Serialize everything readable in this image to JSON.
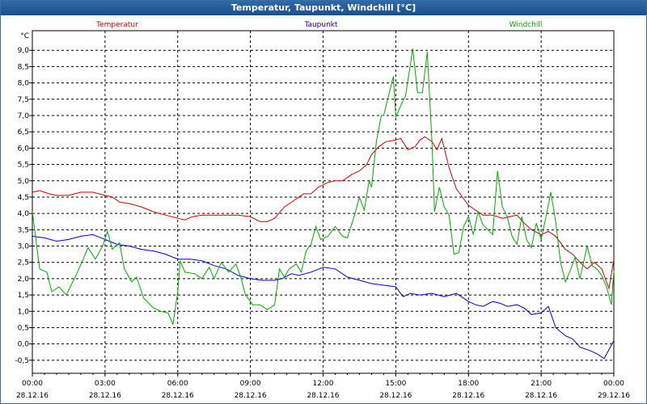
{
  "window": {
    "title": "Temperatur, Taupunkt, Windchill [°C]"
  },
  "chart_data": {
    "type": "line",
    "title": "Temperatur, Taupunkt, Windchill [°C]",
    "ylabel": "°C",
    "ylim": [
      -0.9,
      9.6
    ],
    "xlim_hours": [
      0,
      24
    ],
    "yticks": [
      -0.5,
      0.0,
      0.5,
      1.0,
      1.5,
      2.0,
      2.5,
      3.0,
      3.5,
      4.0,
      4.5,
      5.0,
      5.5,
      6.0,
      6.5,
      7.0,
      7.5,
      8.0,
      8.5,
      9.0
    ],
    "ytick_labels": [
      "-0,5",
      "0,0",
      "0,5",
      "1,0",
      "1,5",
      "2,0",
      "2,5",
      "3,0",
      "3,5",
      "4,0",
      "4,5",
      "5,0",
      "5,5",
      "6,0",
      "6,5",
      "7,0",
      "7,5",
      "8,0",
      "8,5",
      "9,0"
    ],
    "xticks": [
      {
        "hour": 0,
        "time": "00:00",
        "date": "28.12.16"
      },
      {
        "hour": 3,
        "time": "03:00",
        "date": "28.12.16"
      },
      {
        "hour": 6,
        "time": "06:00",
        "date": "28.12.16"
      },
      {
        "hour": 9,
        "time": "09:00",
        "date": "28.12.16"
      },
      {
        "hour": 12,
        "time": "12:00",
        "date": "28.12.16"
      },
      {
        "hour": 15,
        "time": "15:00",
        "date": "28.12.16"
      },
      {
        "hour": 18,
        "time": "18:00",
        "date": "28.12.16"
      },
      {
        "hour": 21,
        "time": "21:00",
        "date": "28.12.16"
      },
      {
        "hour": 24,
        "time": "00:00",
        "date": "29.12.16"
      }
    ],
    "grid": true,
    "legend_position": "top",
    "series": [
      {
        "name": "Temperatur",
        "color": "#cc0000",
        "points": [
          [
            0,
            4.65
          ],
          [
            0.3,
            4.7
          ],
          [
            0.7,
            4.6
          ],
          [
            1,
            4.55
          ],
          [
            1.5,
            4.55
          ],
          [
            2,
            4.65
          ],
          [
            2.5,
            4.65
          ],
          [
            3,
            4.55
          ],
          [
            3.3,
            4.5
          ],
          [
            3.6,
            4.35
          ],
          [
            4,
            4.3
          ],
          [
            4.5,
            4.2
          ],
          [
            5,
            4.05
          ],
          [
            5.5,
            3.95
          ],
          [
            6,
            3.85
          ],
          [
            6.3,
            3.8
          ],
          [
            6.6,
            3.9
          ],
          [
            7,
            3.95
          ],
          [
            7.5,
            3.95
          ],
          [
            8,
            3.95
          ],
          [
            8.5,
            3.95
          ],
          [
            9,
            3.9
          ],
          [
            9.4,
            3.75
          ],
          [
            9.7,
            3.75
          ],
          [
            10,
            3.85
          ],
          [
            10.4,
            4.2
          ],
          [
            10.8,
            4.4
          ],
          [
            11.2,
            4.6
          ],
          [
            11.5,
            4.6
          ],
          [
            11.8,
            4.8
          ],
          [
            12.2,
            4.95
          ],
          [
            12.5,
            5.0
          ],
          [
            12.8,
            5.0
          ],
          [
            13.2,
            5.2
          ],
          [
            13.5,
            5.3
          ],
          [
            13.8,
            5.5
          ],
          [
            14,
            5.8
          ],
          [
            14.3,
            6.05
          ],
          [
            14.6,
            6.2
          ],
          [
            15,
            6.25
          ],
          [
            15.2,
            6.3
          ],
          [
            15.5,
            5.95
          ],
          [
            15.8,
            6.05
          ],
          [
            16,
            6.25
          ],
          [
            16.2,
            6.35
          ],
          [
            16.5,
            6.2
          ],
          [
            16.7,
            5.95
          ],
          [
            16.9,
            6.3
          ],
          [
            17.2,
            5.4
          ],
          [
            17.5,
            4.75
          ],
          [
            17.8,
            4.45
          ],
          [
            18,
            4.25
          ],
          [
            18.3,
            4.1
          ],
          [
            18.6,
            3.95
          ],
          [
            19,
            3.95
          ],
          [
            19.4,
            3.85
          ],
          [
            19.7,
            3.9
          ],
          [
            20,
            3.95
          ],
          [
            20.3,
            3.7
          ],
          [
            20.6,
            3.5
          ],
          [
            21,
            3.35
          ],
          [
            21.3,
            3.45
          ],
          [
            21.6,
            3.3
          ],
          [
            22,
            2.9
          ],
          [
            22.3,
            2.75
          ],
          [
            22.6,
            2.5
          ],
          [
            22.9,
            2.3
          ],
          [
            23.2,
            2.5
          ],
          [
            23.5,
            2.3
          ],
          [
            23.8,
            1.7
          ],
          [
            24,
            2.6
          ]
        ]
      },
      {
        "name": "Taupunkt",
        "color": "#0000cc",
        "points": [
          [
            0,
            3.3
          ],
          [
            0.5,
            3.25
          ],
          [
            1,
            3.15
          ],
          [
            1.5,
            3.2
          ],
          [
            2,
            3.3
          ],
          [
            2.5,
            3.35
          ],
          [
            3,
            3.2
          ],
          [
            3.5,
            3.05
          ],
          [
            4,
            3.0
          ],
          [
            4.5,
            2.9
          ],
          [
            5,
            2.85
          ],
          [
            5.5,
            2.75
          ],
          [
            6,
            2.6
          ],
          [
            6.5,
            2.6
          ],
          [
            7,
            2.55
          ],
          [
            7.5,
            2.4
          ],
          [
            8,
            2.3
          ],
          [
            8.5,
            2.1
          ],
          [
            9,
            2.0
          ],
          [
            9.5,
            1.95
          ],
          [
            10,
            1.95
          ],
          [
            10.3,
            2.0
          ],
          [
            10.7,
            2.15
          ],
          [
            11,
            2.1
          ],
          [
            11.5,
            2.2
          ],
          [
            12,
            2.35
          ],
          [
            12.5,
            2.3
          ],
          [
            13,
            2.05
          ],
          [
            13.5,
            1.95
          ],
          [
            14,
            1.85
          ],
          [
            14.5,
            1.8
          ],
          [
            15,
            1.75
          ],
          [
            15.3,
            1.45
          ],
          [
            15.6,
            1.55
          ],
          [
            16,
            1.5
          ],
          [
            16.5,
            1.55
          ],
          [
            17,
            1.45
          ],
          [
            17.5,
            1.55
          ],
          [
            18,
            1.3
          ],
          [
            18.3,
            1.2
          ],
          [
            18.6,
            1.15
          ],
          [
            19,
            1.3
          ],
          [
            19.3,
            1.25
          ],
          [
            19.6,
            1.15
          ],
          [
            20,
            1.2
          ],
          [
            20.3,
            1.1
          ],
          [
            20.6,
            0.9
          ],
          [
            21,
            0.95
          ],
          [
            21.3,
            1.15
          ],
          [
            21.6,
            0.5
          ],
          [
            22,
            0.25
          ],
          [
            22.3,
            0.15
          ],
          [
            22.6,
            -0.1
          ],
          [
            23,
            -0.2
          ],
          [
            23.3,
            -0.3
          ],
          [
            23.6,
            -0.45
          ],
          [
            24,
            0.1
          ]
        ]
      },
      {
        "name": "Windchill",
        "color": "#00aa00",
        "points": [
          [
            0,
            4.05
          ],
          [
            0.3,
            2.3
          ],
          [
            0.6,
            2.2
          ],
          [
            0.8,
            1.6
          ],
          [
            1.1,
            1.75
          ],
          [
            1.4,
            1.5
          ],
          [
            1.8,
            2.1
          ],
          [
            2.1,
            2.6
          ],
          [
            2.3,
            2.95
          ],
          [
            2.6,
            2.6
          ],
          [
            2.9,
            3.0
          ],
          [
            3.1,
            3.45
          ],
          [
            3.3,
            2.9
          ],
          [
            3.6,
            3.1
          ],
          [
            3.8,
            2.3
          ],
          [
            4.1,
            1.9
          ],
          [
            4.3,
            2.05
          ],
          [
            4.6,
            1.4
          ],
          [
            5,
            1.1
          ],
          [
            5.3,
            1.0
          ],
          [
            5.6,
            0.95
          ],
          [
            5.8,
            0.6
          ],
          [
            6,
            1.6
          ],
          [
            6.1,
            2.55
          ],
          [
            6.3,
            2.2
          ],
          [
            6.7,
            2.15
          ],
          [
            7,
            2.0
          ],
          [
            7.3,
            2.35
          ],
          [
            7.5,
            2.0
          ],
          [
            7.8,
            2.5
          ],
          [
            8.1,
            2.2
          ],
          [
            8.4,
            2.45
          ],
          [
            8.6,
            2.05
          ],
          [
            8.8,
            1.5
          ],
          [
            9.1,
            1.2
          ],
          [
            9.4,
            1.2
          ],
          [
            9.7,
            1.05
          ],
          [
            10,
            1.2
          ],
          [
            10.2,
            2.3
          ],
          [
            10.4,
            2.05
          ],
          [
            10.6,
            2.3
          ],
          [
            10.9,
            2.45
          ],
          [
            11.1,
            2.2
          ],
          [
            11.3,
            2.85
          ],
          [
            11.5,
            3.05
          ],
          [
            11.7,
            3.6
          ],
          [
            11.9,
            3.2
          ],
          [
            12.2,
            3.3
          ],
          [
            12.5,
            3.6
          ],
          [
            12.8,
            3.3
          ],
          [
            13,
            3.25
          ],
          [
            13.3,
            3.95
          ],
          [
            13.5,
            4.5
          ],
          [
            13.7,
            4.1
          ],
          [
            13.9,
            5.0
          ],
          [
            14,
            4.8
          ],
          [
            14.2,
            6.2
          ],
          [
            14.4,
            7.0
          ],
          [
            14.5,
            7.0
          ],
          [
            14.7,
            7.6
          ],
          [
            14.9,
            8.2
          ],
          [
            15,
            6.95
          ],
          [
            15.2,
            7.3
          ],
          [
            15.4,
            7.6
          ],
          [
            15.6,
            8.55
          ],
          [
            15.7,
            9.05
          ],
          [
            15.9,
            7.7
          ],
          [
            16.1,
            7.7
          ],
          [
            16.3,
            8.95
          ],
          [
            16.5,
            6.1
          ],
          [
            16.6,
            4.05
          ],
          [
            16.8,
            4.8
          ],
          [
            17,
            4.2
          ],
          [
            17.2,
            3.95
          ],
          [
            17.4,
            2.75
          ],
          [
            17.6,
            2.8
          ],
          [
            17.8,
            3.6
          ],
          [
            18,
            3.9
          ],
          [
            18.2,
            3.35
          ],
          [
            18.4,
            4.05
          ],
          [
            18.6,
            3.65
          ],
          [
            18.8,
            3.5
          ],
          [
            19,
            3.35
          ],
          [
            19.2,
            5.3
          ],
          [
            19.4,
            4.2
          ],
          [
            19.6,
            3.9
          ],
          [
            19.8,
            3.3
          ],
          [
            20,
            3.05
          ],
          [
            20.2,
            3.9
          ],
          [
            20.4,
            3.2
          ],
          [
            20.6,
            2.95
          ],
          [
            20.8,
            3.7
          ],
          [
            21,
            3.2
          ],
          [
            21.2,
            3.9
          ],
          [
            21.4,
            4.65
          ],
          [
            21.6,
            3.75
          ],
          [
            21.8,
            2.5
          ],
          [
            22,
            1.9
          ],
          [
            22.2,
            2.25
          ],
          [
            22.4,
            2.65
          ],
          [
            22.6,
            2.0
          ],
          [
            22.9,
            3.0
          ],
          [
            23.1,
            2.4
          ],
          [
            23.3,
            2.3
          ],
          [
            23.5,
            2.1
          ],
          [
            23.7,
            1.75
          ],
          [
            23.9,
            1.2
          ],
          [
            24,
            2.25
          ]
        ]
      }
    ]
  }
}
